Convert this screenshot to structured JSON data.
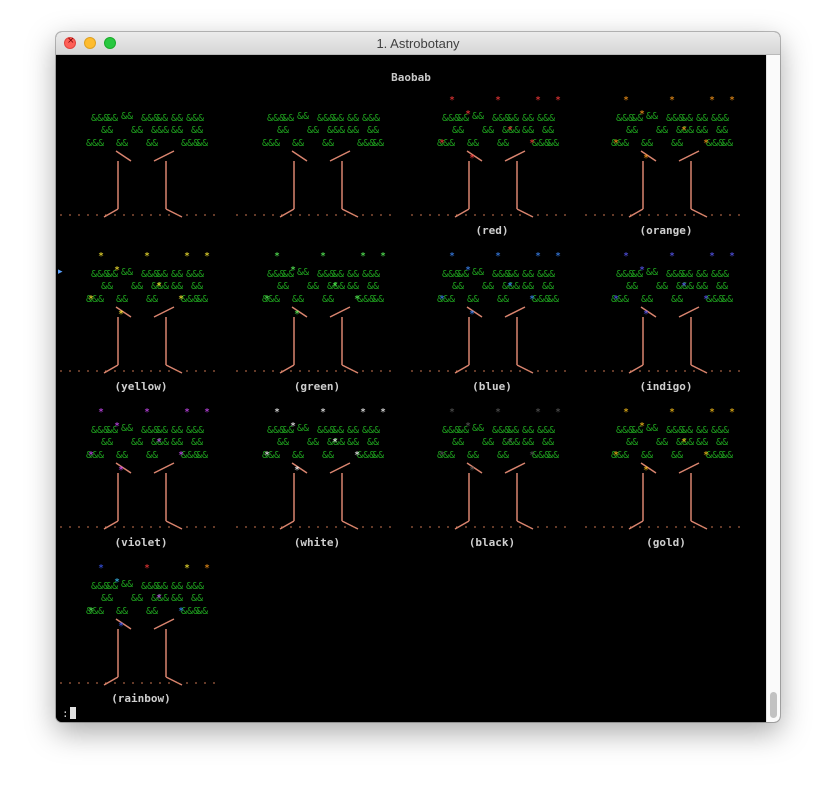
{
  "window": {
    "title": "1. Astrobotany"
  },
  "header": {
    "species": "Baobab"
  },
  "trees": [
    {
      "label": "",
      "color": "none"
    },
    {
      "label": "",
      "color": "none"
    },
    {
      "label": "(red)",
      "color": "#ff3b3b"
    },
    {
      "label": "(orange)",
      "color": "#ff9a1a"
    },
    {
      "label": "(yellow)",
      "color": "#ffee33"
    },
    {
      "label": "(green)",
      "color": "#5dff5d"
    },
    {
      "label": "(blue)",
      "color": "#3d8bff"
    },
    {
      "label": "(indigo)",
      "color": "#5b5bff"
    },
    {
      "label": "(violet)",
      "color": "#d44dff"
    },
    {
      "label": "(white)",
      "color": "#ffffff"
    },
    {
      "label": "(black)",
      "color": "#5a5a5a"
    },
    {
      "label": "(gold)",
      "color": "#ffc41a"
    },
    {
      "label": "(rainbow)",
      "color": "rainbow"
    }
  ],
  "colors": {
    "leaf": "#1ea01e",
    "trunk": "#d9846f",
    "ground": "#c7754f"
  },
  "prompt": {
    "text": ":"
  }
}
